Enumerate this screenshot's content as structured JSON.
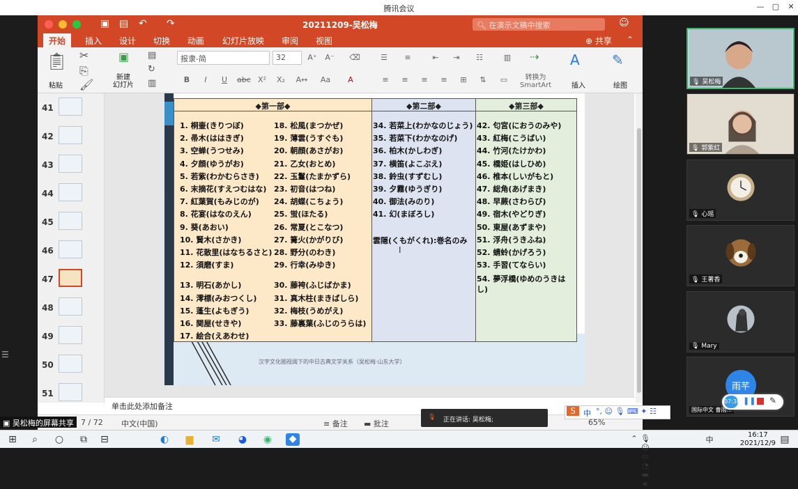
{
  "meeting": {
    "window_title": "腾讯会议",
    "min": "—",
    "restore": "▢",
    "close": "✕"
  },
  "ppt": {
    "doc_title": "20211209-吴松梅",
    "search_placeholder": "在演示文稿中搜索",
    "tabs": [
      "开始",
      "插入",
      "设计",
      "切换",
      "动画",
      "幻灯片放映",
      "审阅",
      "视图"
    ],
    "share_label": "共享",
    "ribbon": {
      "paste": "粘贴",
      "new_slide": "新建\n幻灯片",
      "font_name": "报隶-简",
      "font_size": "32",
      "convert_smartart": "转换为\nSmartArt",
      "insert": "插入",
      "draw": "绘图"
    },
    "thumbnails": [
      {
        "num": "41"
      },
      {
        "num": "42"
      },
      {
        "num": "43"
      },
      {
        "num": "44"
      },
      {
        "num": "45"
      },
      {
        "num": "46"
      },
      {
        "num": "47"
      },
      {
        "num": "48"
      },
      {
        "num": "49"
      },
      {
        "num": "50"
      },
      {
        "num": "51"
      }
    ],
    "notes_placeholder": "单击此处添加备注",
    "status": {
      "slide_of": "7 / 72",
      "language": "中文(中国)",
      "notes": "备注",
      "comments": "批注",
      "zoom": "65%"
    }
  },
  "slide": {
    "headers": [
      "◆第一部◆",
      "◆第二部◆",
      "◆第三部◆"
    ],
    "part1_col1": [
      "1. 桐壷(きりつぼ)",
      "2. 帚木(ははきぎ)",
      "3. 空蝉(うつせみ)",
      "4. 夕顔(ゆうがお)",
      "5. 若紫(わかむらさき)",
      "6. 末摘花(すえつむはな)",
      "7. 紅葉賀(もみじのが)",
      "8. 花宴(はなのえん)",
      "9. 葵(あおい)",
      "10. 賢木(さかき)",
      "11. 花散里(はなちるさと)",
      "12. 須磨(すま)",
      "13. 明石(あかし)",
      "14. 澪標(みおつくし)",
      "15. 蓬生(よもぎう)",
      "16. 関屋(せきや)",
      "17. 絵合(えあわせ)"
    ],
    "part1_col2": [
      "18. 松風(まつかぜ)",
      "19. 薄雲(うすぐも)",
      "20. 朝顔(あさがお)",
      "21. 乙女(おとめ)",
      "22. 玉鬘(たまかずら)",
      "23. 初音(はつね)",
      "24. 胡蝶(こちょう)",
      "25. 蛍(ほたる)",
      "26. 常夏(とこなつ)",
      "27. 篝火(かがりび)",
      "28. 野分(のわき)",
      "29. 行幸(みゆき)",
      "30. 藤袴(ふじばかま)",
      "31. 真木柱(まきばしら)",
      "32. 梅枝(うめがえ)",
      "33. 藤裏葉(ふじのうらは)"
    ],
    "part2": [
      "34. 若菜上(わかなのじょう)",
      "35. 若菜下(わかなのげ)",
      "36. 柏木(かしわぎ)",
      "37. 横笛(よこぶえ)",
      "38. 鈴虫(すずむし)",
      "39. 夕霧(ゆうぎり)",
      "40. 御法(みのり)",
      "41. 幻(まぼろし)"
    ],
    "part2_note": "雲隠(くもがくれ):巻名のみ",
    "part3": [
      "42. 匂宮(におうのみや)",
      "43. 紅梅(こうばい)",
      "44. 竹河(たけかわ)",
      "45. 橋姫(はしひめ)",
      "46. 椎本(しいがもと)",
      "47. 総角(あげまき)",
      "48. 早蕨(さわらび)",
      "49. 宿木(やどりぎ)",
      "50. 東屋(あずまや)",
      "51. 浮舟(うきふね)",
      "52. 蜻蛉(かげろう)",
      "53. 手習(てならい)",
      "54. 夢浮橋(ゆめのうきは",
      "し)"
    ],
    "footer": "汉字文化圈视阈下的中日古典文学关系（吴松梅·山东大学）",
    "colors": {
      "part1": "#fde9c8",
      "part2": "#dde3f0",
      "part3": "#e3efdc"
    }
  },
  "participants": [
    {
      "name": "吴松梅",
      "active": true
    },
    {
      "name": "郭紫红",
      "active": false
    },
    {
      "name": "心瑶",
      "active": false
    },
    {
      "name": "王著香",
      "active": false
    },
    {
      "name": "Mary",
      "active": false
    },
    {
      "name": "国际中文 曹雨...",
      "avatar_text": "雨芊",
      "active": false
    }
  ],
  "share": {
    "label": "吴松梅的屏幕共享",
    "speaking": "正在讲话: 吴松梅;"
  },
  "record": {
    "time": "07:38"
  },
  "taskbar": {
    "time": "16:17",
    "date": "2021/12/9",
    "ime": "中"
  }
}
